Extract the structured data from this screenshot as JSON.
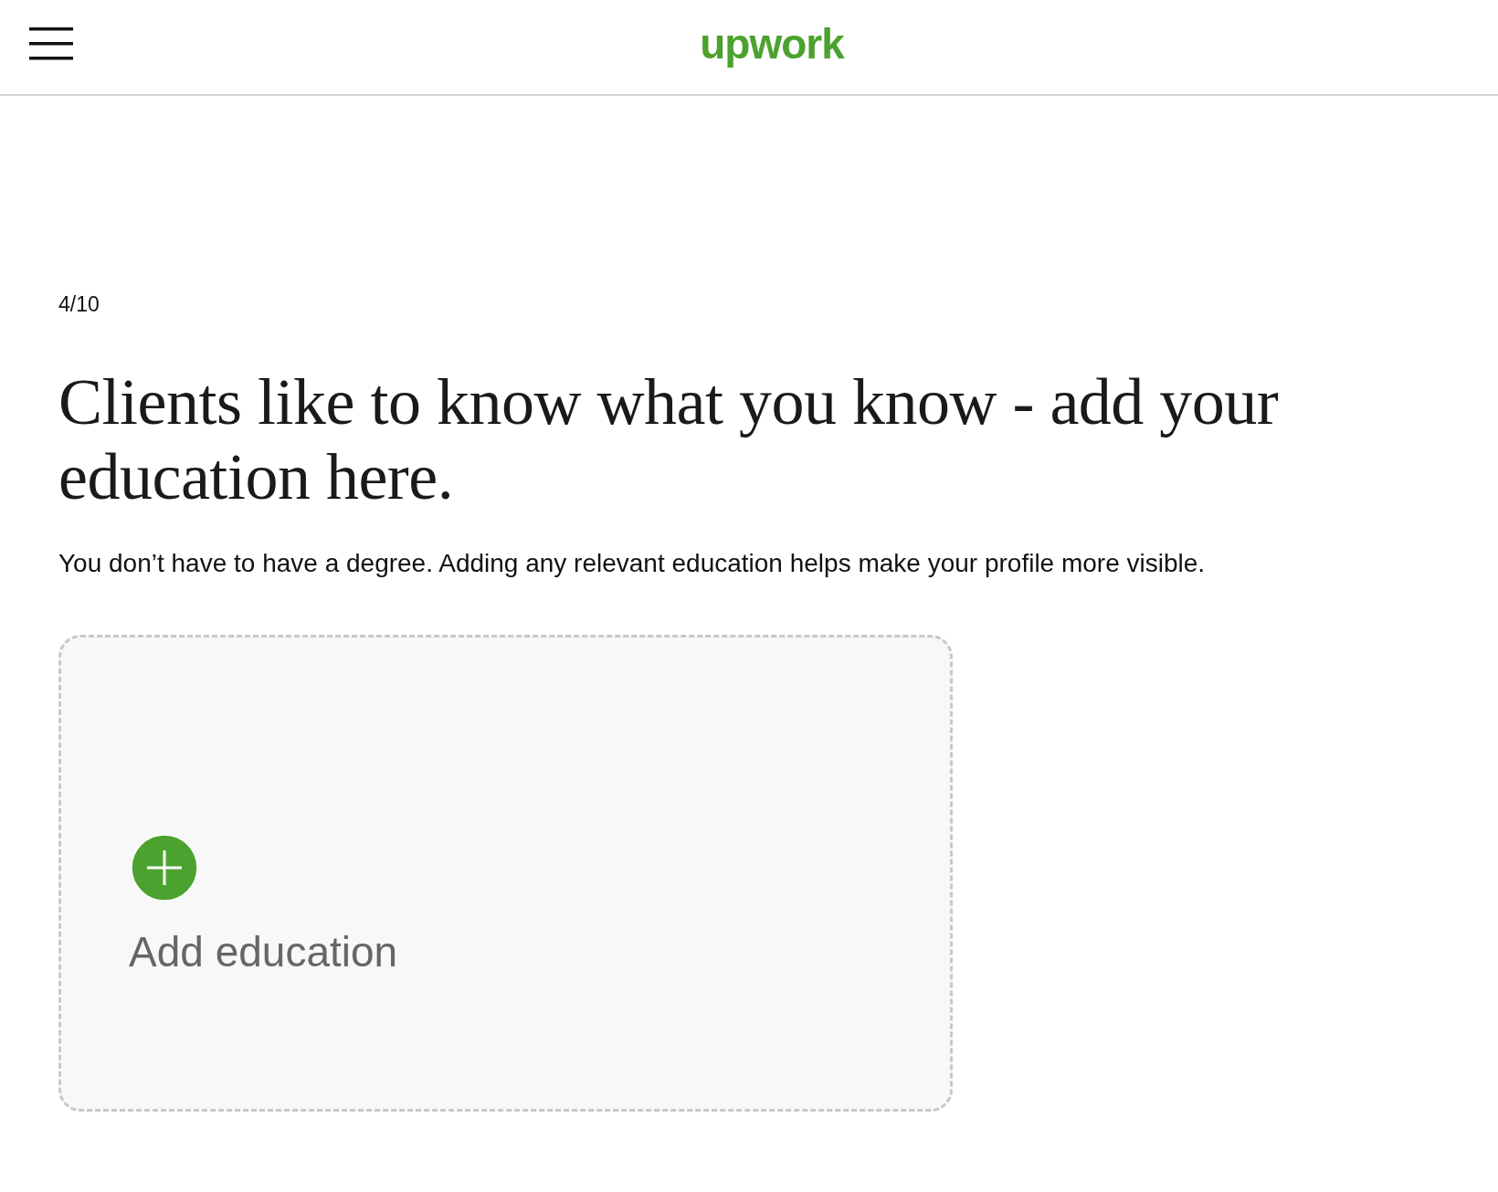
{
  "header": {
    "logo": "upwork"
  },
  "step": "4/10",
  "title": "Clients like to know what you know - add your education here.",
  "subtitle": "You don’t have to have a degree. Adding any relevant education helps make your profile more visible.",
  "add_card": {
    "label": "Add education"
  }
}
